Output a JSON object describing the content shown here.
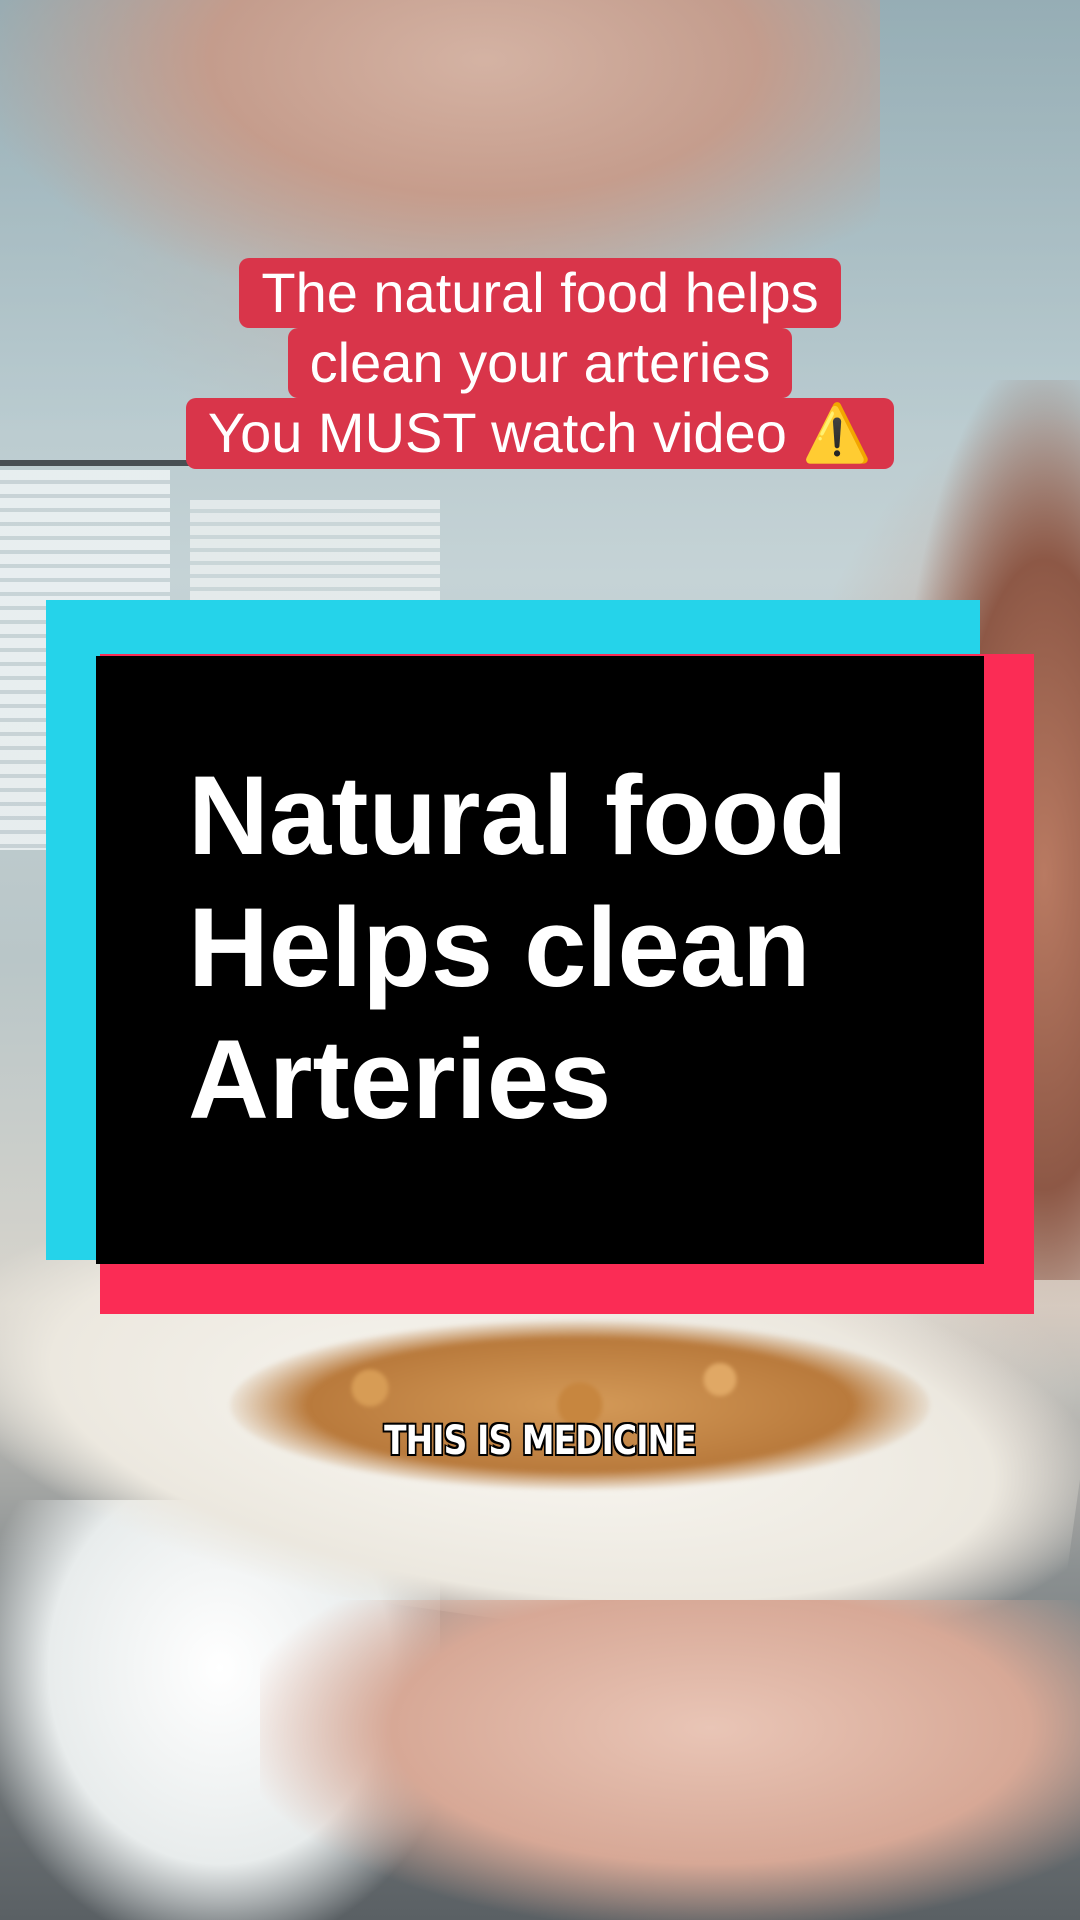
{
  "caption": {
    "lines": [
      "The natural food helps",
      "clean your arteries",
      "You MUST watch video"
    ],
    "warning_icon": "warning-icon",
    "background_color": "#d9354a"
  },
  "title_card": {
    "lines": [
      "Natural food",
      "Helps clean",
      "Arteries"
    ],
    "colors": {
      "cyan": "#25d3ea",
      "red": "#fb2c55",
      "black": "#000000"
    }
  },
  "subtitle": "THIS IS MEDICINE"
}
